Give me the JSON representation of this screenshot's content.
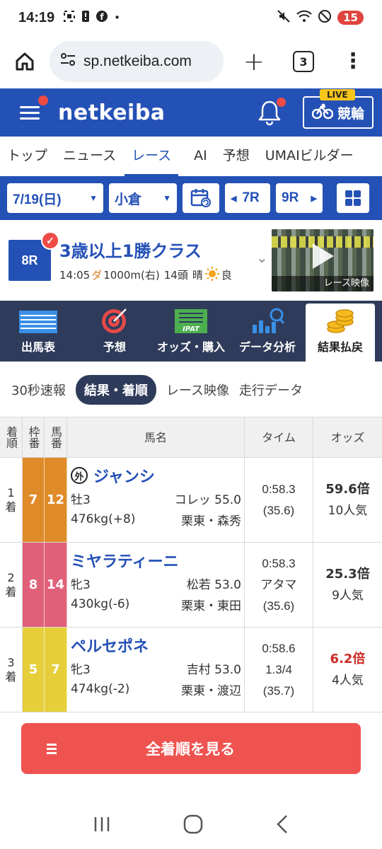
{
  "status": {
    "time": "14:19",
    "battery": "15"
  },
  "browser": {
    "url": "sp.netkeiba.com",
    "tab_count": "3"
  },
  "site": {
    "logo": "netkeiba",
    "live_badge": "LIVE",
    "live_label": "競輪"
  },
  "nav": {
    "tabs": [
      "トップ",
      "ニュース",
      "レース",
      "AI",
      "予想",
      "UMAIビルダー"
    ],
    "active": "レース"
  },
  "selector": {
    "date": "7/19(日)",
    "venue": "小倉",
    "prev": "7R",
    "next": "9R"
  },
  "race": {
    "number": "8R",
    "name": "3歳以上1勝クラス",
    "start": "14:05",
    "surface": "ダ",
    "distance": "1000m(右)",
    "field": "14頭",
    "weather": "晴",
    "condition": "良",
    "video_label": "レース映像"
  },
  "actions": [
    {
      "label": "出馬表",
      "icon": "entry-list-icon"
    },
    {
      "label": "予想",
      "icon": "target-icon"
    },
    {
      "label": "オッズ・購入",
      "icon": "ipat-icon"
    },
    {
      "label": "データ分析",
      "icon": "data-chart-icon"
    },
    {
      "label": "結果払戻",
      "icon": "coins-icon"
    }
  ],
  "subtabs": [
    "30秒速報",
    "結果・着順",
    "レース映像",
    "走行データ"
  ],
  "table": {
    "headers": {
      "rank": "着順",
      "waku": "枠番",
      "uma": "馬番",
      "name": "馬名",
      "time": "タイム",
      "odds": "オッズ"
    },
    "rows": [
      {
        "rank": "1",
        "rank_suffix": "着",
        "waku": "7",
        "uma": "12",
        "gaikoku": "外",
        "name": "ジャンシ",
        "sexage": "牡3",
        "jockey": "コレッ 55.0",
        "weight": "476kg(+8)",
        "trainer": "栗東・森秀",
        "time": "0:58.3",
        "margin": "",
        "last3f": "(35.6)",
        "odds": "59.6倍",
        "popularity": "10人気"
      },
      {
        "rank": "2",
        "rank_suffix": "着",
        "waku": "8",
        "uma": "14",
        "gaikoku": "",
        "name": "ミヤラティーニ",
        "sexage": "牝3",
        "jockey": "松若 53.0",
        "weight": "430kg(-6)",
        "trainer": "栗東・東田",
        "time": "0:58.3",
        "margin": "アタマ",
        "last3f": "(35.6)",
        "odds": "25.3倍",
        "popularity": "9人気"
      },
      {
        "rank": "3",
        "rank_suffix": "着",
        "waku": "5",
        "uma": "7",
        "gaikoku": "",
        "name": "ペルセポネ",
        "sexage": "牝3",
        "jockey": "吉村 53.0",
        "weight": "474kg(-2)",
        "trainer": "栗東・渡辺",
        "time": "0:58.6",
        "margin": "1.3/4",
        "last3f": "(35.7)",
        "odds": "6.2倍",
        "popularity": "4人気"
      }
    ]
  },
  "see_all": "全着順を見る",
  "colors": {
    "brand": "#2451b6",
    "dark_nav": "#2f3b5a",
    "waku7": "#e08b2a",
    "waku8": "#e0607a",
    "waku5": "#e6cf3a",
    "button": "#ef5350"
  }
}
